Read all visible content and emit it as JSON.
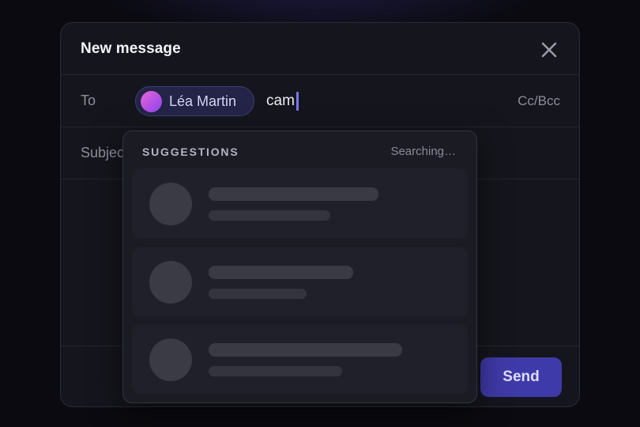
{
  "modal": {
    "title": "New message",
    "close_icon": "close-icon"
  },
  "to_field": {
    "label": "To",
    "recipient": {
      "name": "Léa Martin",
      "avatar": "gradient-avatar"
    },
    "input_value": "cam",
    "cc_bcc": "Cc/Bcc"
  },
  "subject_field": {
    "label": "Subject"
  },
  "suggestions": {
    "title": "SUGGESTIONS",
    "status": "Searching…",
    "loading_items": 3
  },
  "actions": {
    "send_label": "Send"
  },
  "colors": {
    "accent": "#3f3aa9",
    "caret": "#7b76f5",
    "chip_bg": "#232447",
    "avatar_gradient_start": "#e66ad2",
    "avatar_gradient_end": "#8e4bea"
  }
}
